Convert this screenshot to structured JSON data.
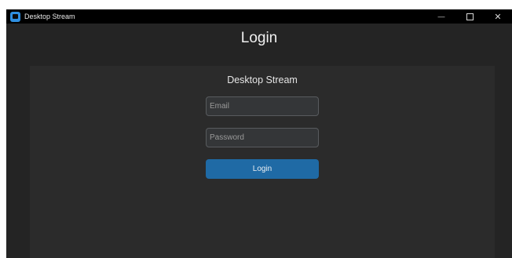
{
  "window": {
    "title": "Desktop Stream",
    "icon": "app-window-icon",
    "controls": {
      "minimize": "—",
      "maximize_icon": "square-outline",
      "close": "✕"
    }
  },
  "header": {
    "title": "Login"
  },
  "form": {
    "title": "Desktop Stream",
    "email_placeholder": "Email",
    "email_value": "",
    "password_placeholder": "Password",
    "password_value": "",
    "submit_label": "Login"
  },
  "colors": {
    "accent": "#1f6aa5",
    "window_bg": "#242424",
    "panel_bg": "#2b2b2b",
    "titlebar_bg": "#000000"
  }
}
